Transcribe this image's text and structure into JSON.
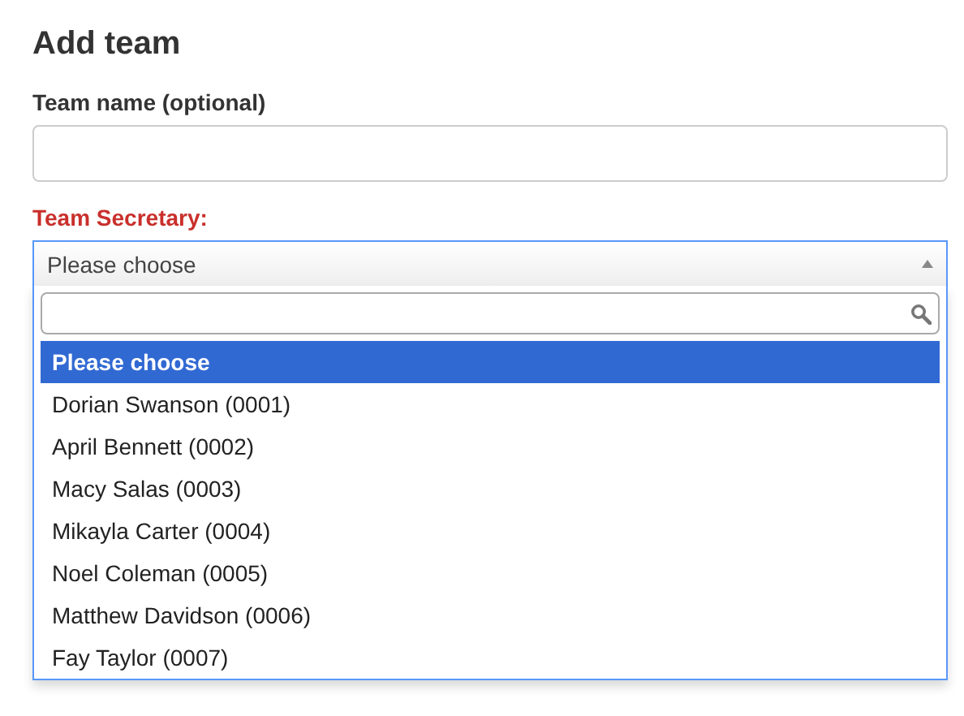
{
  "title": "Add team",
  "team_name": {
    "label": "Team name (optional)"
  },
  "secretary": {
    "label": "Team Secretary:",
    "required": true,
    "value": "Please choose",
    "expanded": true,
    "options": [
      {
        "label": "Please choose",
        "selected": true
      },
      {
        "label": "Dorian Swanson (0001)",
        "selected": false
      },
      {
        "label": "April Bennett (0002)",
        "selected": false
      },
      {
        "label": "Macy Salas (0003)",
        "selected": false
      },
      {
        "label": "Mikayla Carter (0004)",
        "selected": false
      },
      {
        "label": "Noel Coleman (0005)",
        "selected": false
      },
      {
        "label": "Matthew Davidson (0006)",
        "selected": false
      },
      {
        "label": "Fay Taylor (0007)",
        "selected": false
      }
    ]
  }
}
